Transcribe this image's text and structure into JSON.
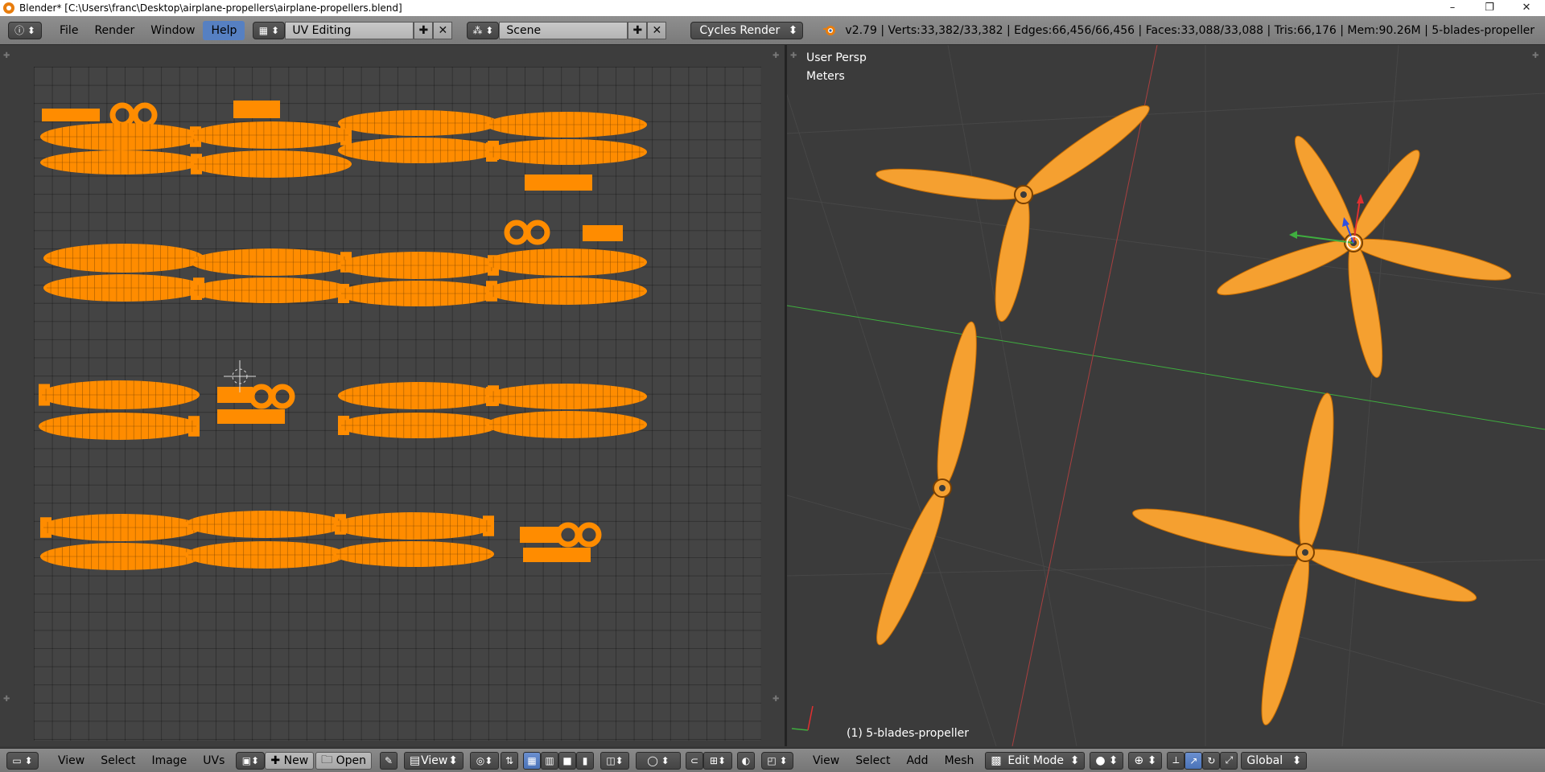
{
  "window": {
    "title": "Blender* [C:\\Users\\franc\\Desktop\\airplane-propellers\\airplane-propellers.blend]",
    "minimize": "–",
    "restore": "❐",
    "close": "✕"
  },
  "header": {
    "menus": [
      "File",
      "Render",
      "Window",
      "Help"
    ],
    "active_menu": "Help",
    "screen_layout": "UV Editing",
    "scene": "Scene",
    "render_engine": "Cycles Render",
    "stats": "v2.79 | Verts:33,382/33,382 | Edges:66,456/66,456 | Faces:33,088/33,088 | Tris:66,176 | Mem:90.26M | 5-blades-propeller"
  },
  "viewport": {
    "view_name": "User Persp",
    "units": "Meters",
    "object_label": "(1) 5-blades-propeller",
    "colors": {
      "mesh": "#f5a030",
      "x_axis": "#c84040",
      "y_axis": "#3fae3f",
      "grid": "#474747"
    }
  },
  "uv_editor": {
    "colors": {
      "island": "#ff8c00",
      "grid_bg": "#444444"
    }
  },
  "uv_footer": {
    "menus": [
      "View",
      "Select",
      "Image",
      "UVs"
    ],
    "new_label": "New",
    "open_label": "Open",
    "view_label": "View"
  },
  "vp_footer": {
    "menus": [
      "View",
      "Select",
      "Add",
      "Mesh"
    ],
    "mode": "Edit Mode",
    "orientation": "Global"
  }
}
